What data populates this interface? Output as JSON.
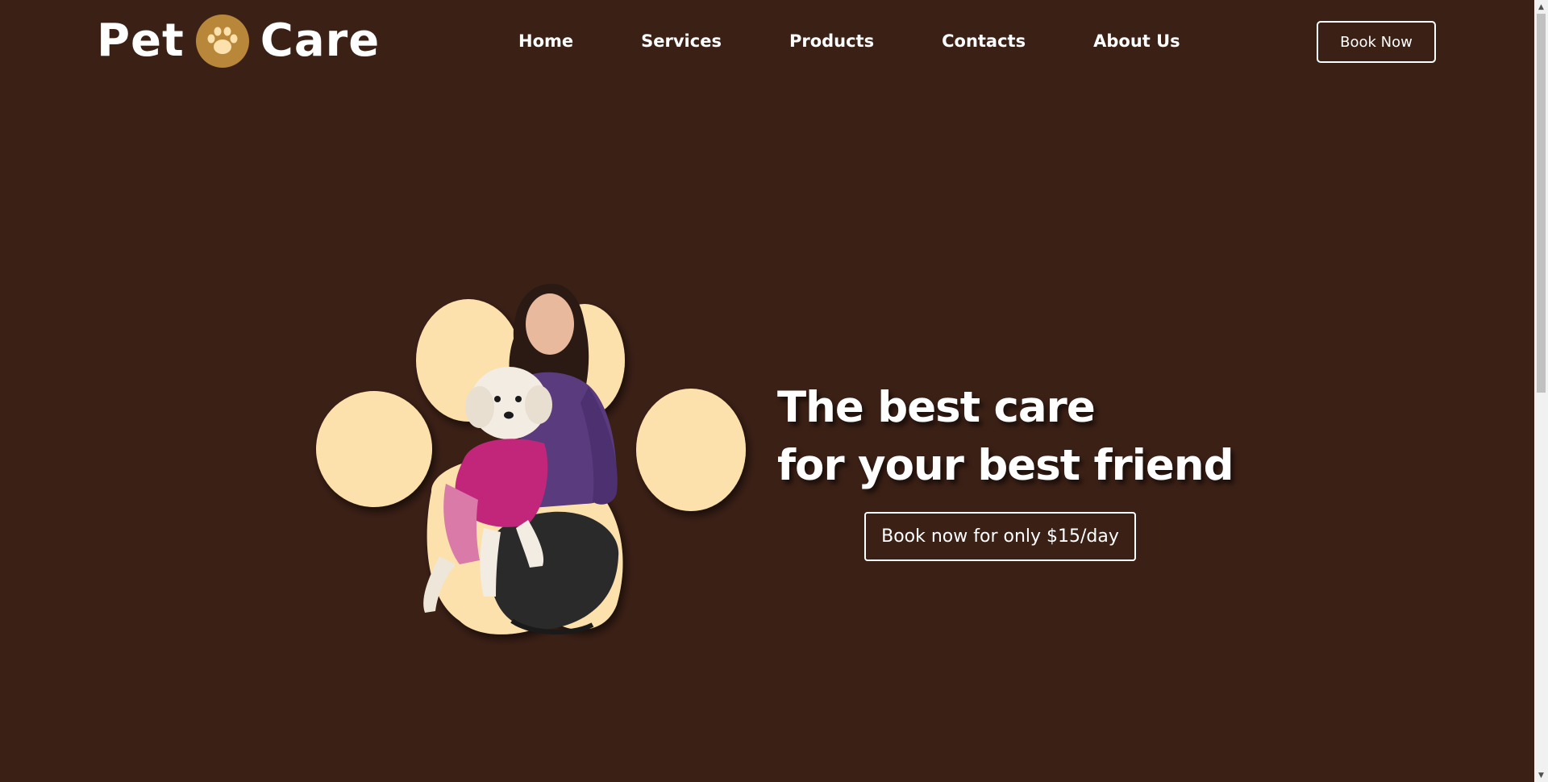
{
  "brand": {
    "word_left": "Pet",
    "word_right": "Care",
    "icon": "paw-icon",
    "badge_color": "#b8873a",
    "paw_color": "#fde1ad"
  },
  "nav": {
    "items": [
      {
        "label": "Home"
      },
      {
        "label": "Services"
      },
      {
        "label": "Products"
      },
      {
        "label": "Contacts"
      },
      {
        "label": "About Us"
      }
    ],
    "book_label": "Book Now"
  },
  "hero": {
    "line1": "The best care",
    "line2": "for your best friend",
    "cta_label": "Book now for only $15/day",
    "image": "woman-with-white-dog-on-paw-shape"
  },
  "colors": {
    "background": "#3b2016",
    "text": "#ffffff",
    "paw": "#fde1ad"
  }
}
